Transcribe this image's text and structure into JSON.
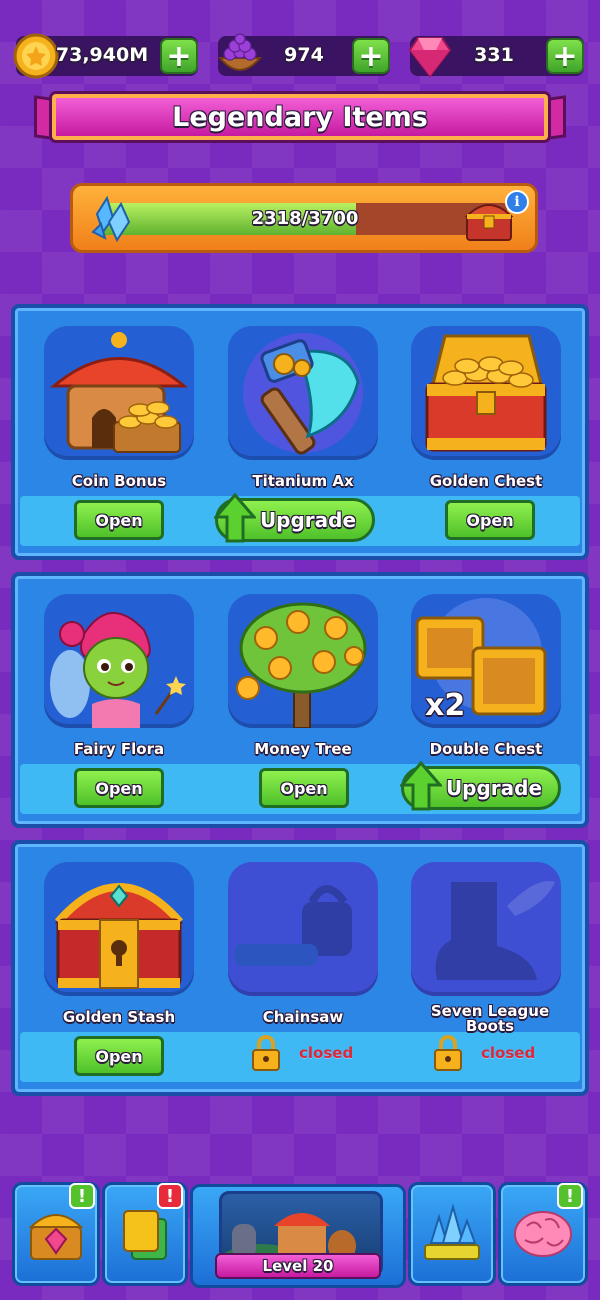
{
  "resources": {
    "coins": {
      "value": "73,940M",
      "icon": "gold-coin-icon"
    },
    "berries": {
      "value": "974",
      "icon": "grape-basket-icon"
    },
    "gems": {
      "value": "331",
      "icon": "pink-gem-icon"
    },
    "plus_label": "+"
  },
  "title": "Legendary Items",
  "progress": {
    "label": "2318/3700",
    "current": 2318,
    "max": 3700,
    "info_label": "i"
  },
  "panels": [
    {
      "items": [
        {
          "name": "Coin Bonus",
          "action": "Open",
          "icon": "coin-bonus-icon"
        },
        {
          "name": "Titanium Ax",
          "action": "Upgrade",
          "icon": "titanium-ax-icon"
        },
        {
          "name": "Golden Chest",
          "action": "Open",
          "icon": "golden-chest-icon"
        }
      ]
    },
    {
      "items": [
        {
          "name": "Fairy Flora",
          "action": "Open",
          "icon": "fairy-icon"
        },
        {
          "name": "Money Tree",
          "action": "Open",
          "icon": "money-tree-icon"
        },
        {
          "name": "Double Chest",
          "action": "Upgrade",
          "icon": "double-chest-icon",
          "badge": "x2"
        }
      ]
    },
    {
      "items": [
        {
          "name": "Golden Stash",
          "action": "Open",
          "icon": "golden-stash-icon"
        },
        {
          "name": "Chainsaw",
          "action": "closed",
          "icon": "chainsaw-icon"
        },
        {
          "name": "Seven League Boots",
          "action": "closed",
          "icon": "winged-boots-icon"
        }
      ]
    }
  ],
  "bottom_nav": {
    "level_label": "Level 20",
    "badge_label": "!",
    "badge_colors": {
      "green": "#53c22d",
      "red": "#e82b3a"
    }
  },
  "colors": {
    "background": "#7a2bbf",
    "panel": "#2c86e6",
    "button_green": "#4fc12a",
    "closed_red": "#e0273a"
  }
}
